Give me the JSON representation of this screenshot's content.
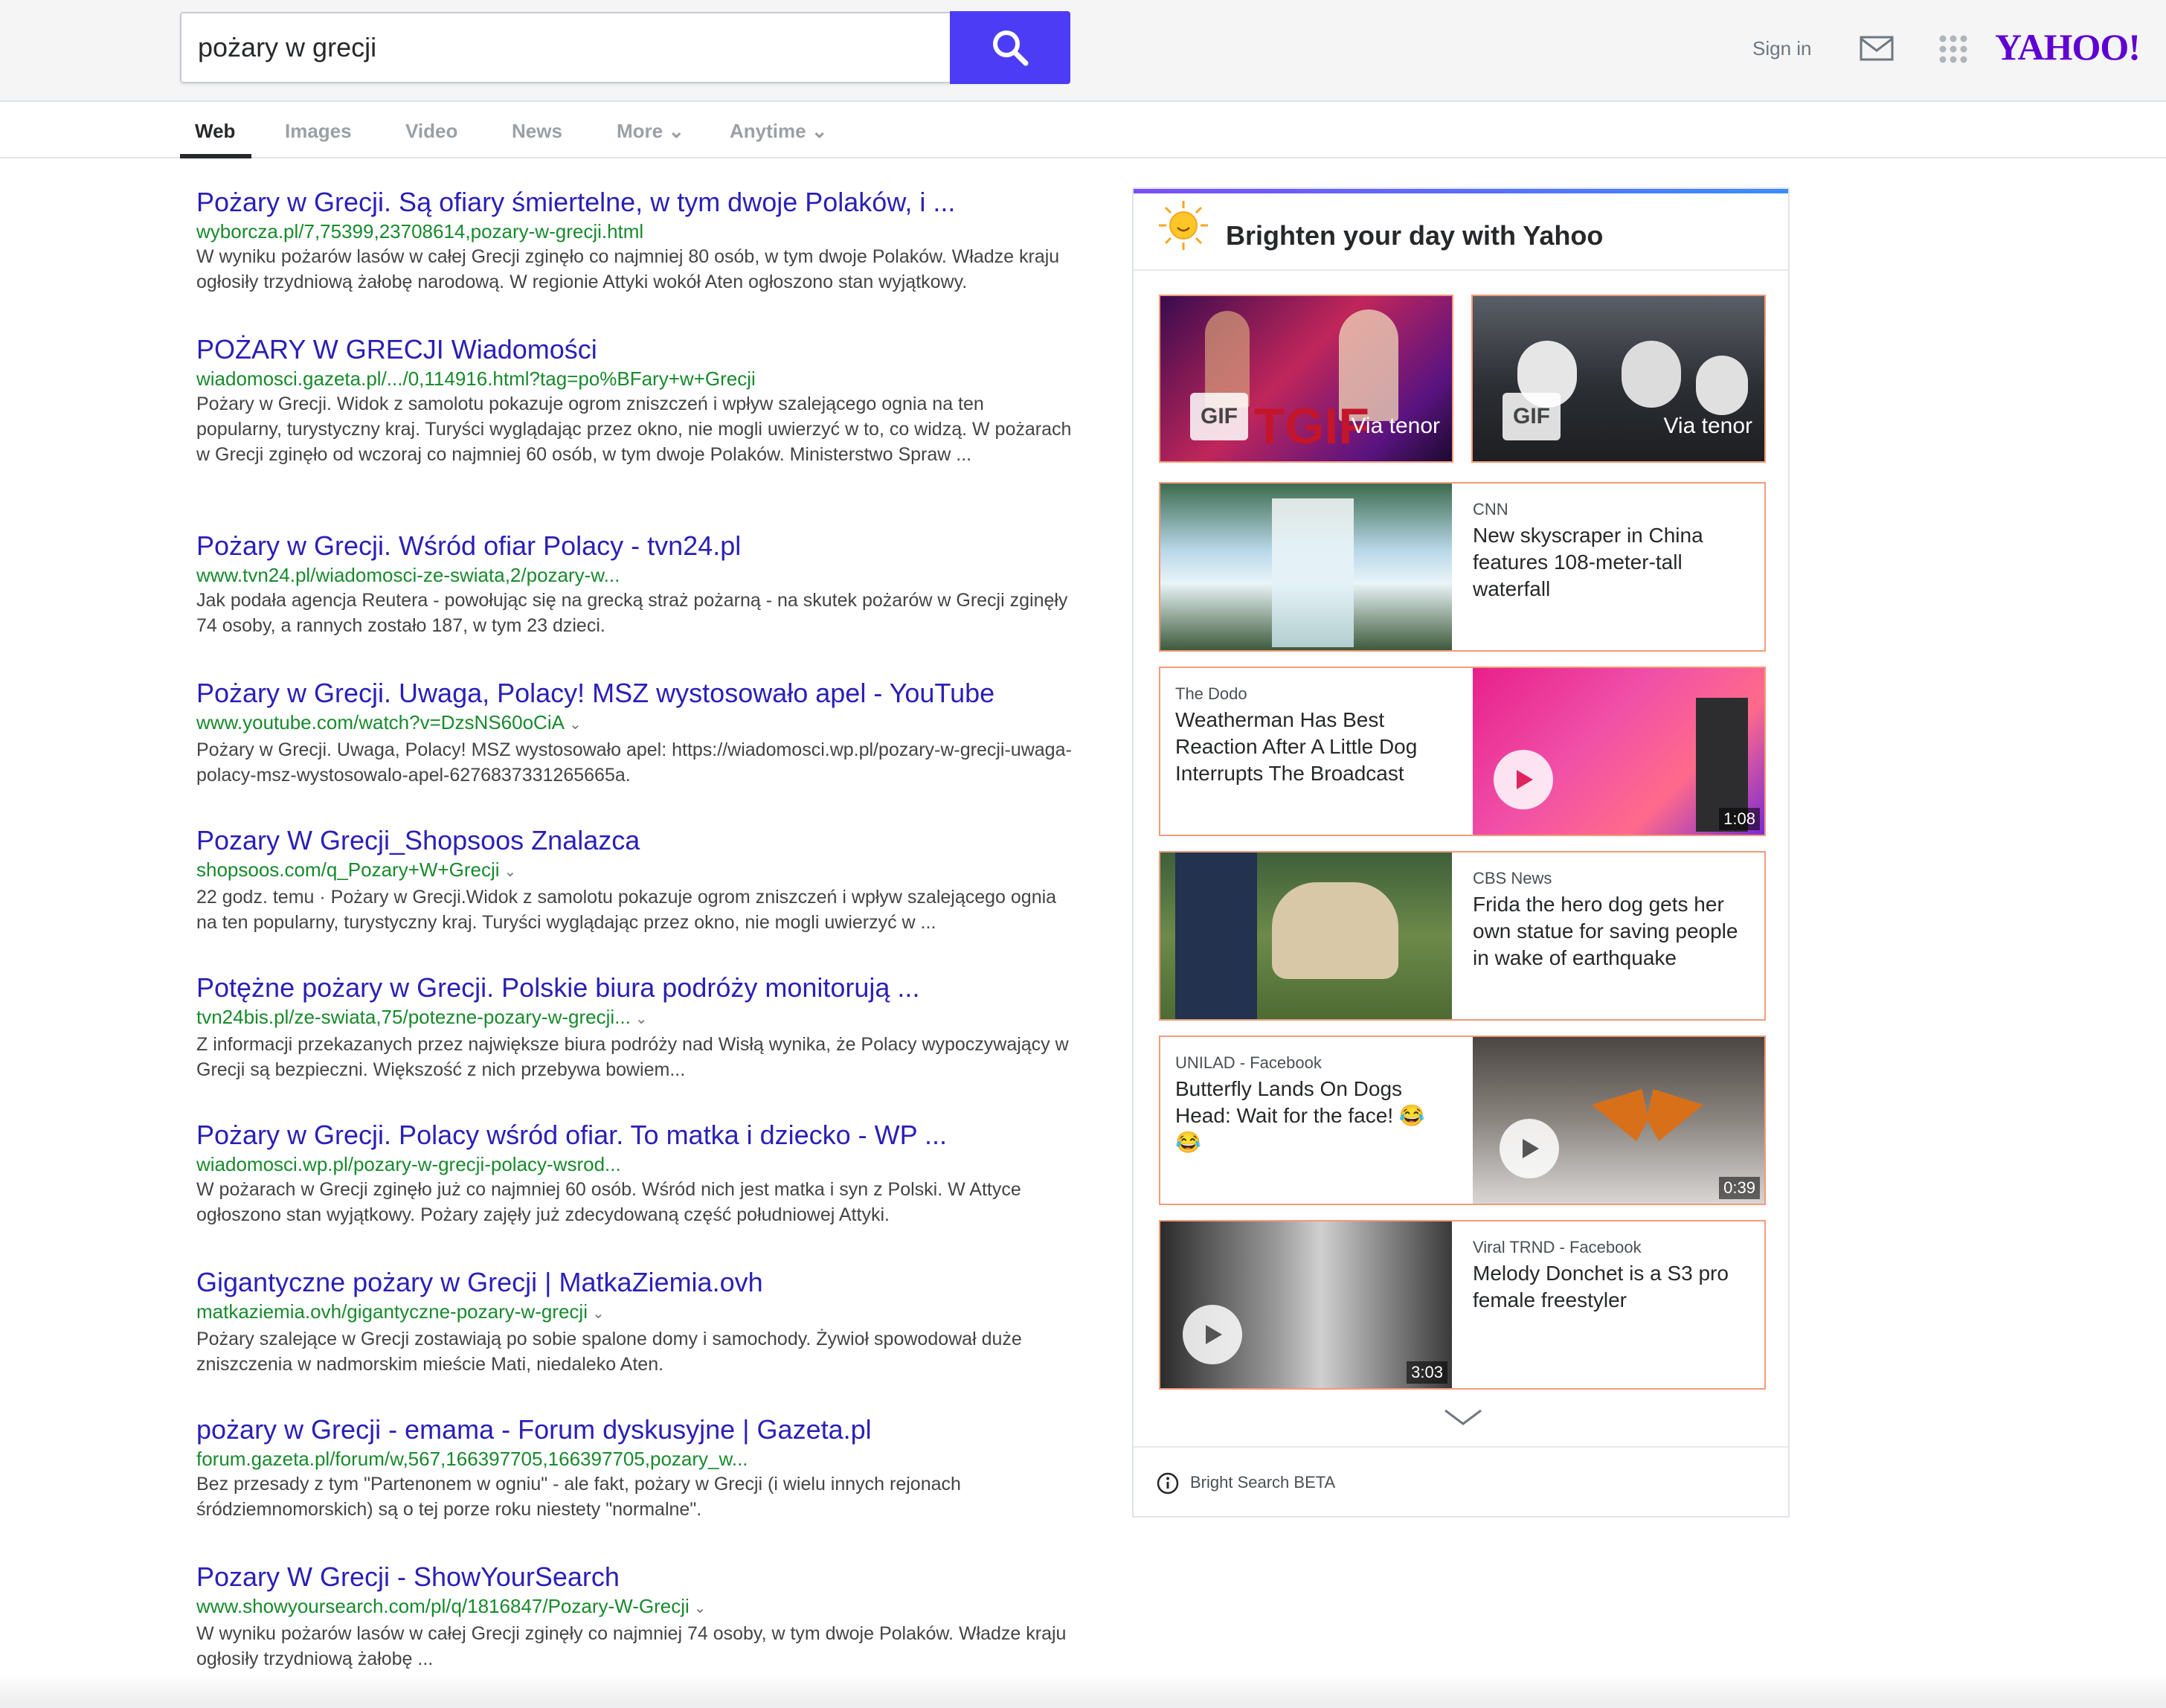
{
  "search": {
    "query": "pożary w grecji"
  },
  "header": {
    "signin": "Sign in",
    "logo": "YAHOO!"
  },
  "tabs": [
    {
      "label": "Web"
    },
    {
      "label": "Images"
    },
    {
      "label": "Video"
    },
    {
      "label": "News"
    },
    {
      "label": "More ⌄"
    },
    {
      "label": "Anytime ⌄"
    }
  ],
  "results": [
    {
      "title": "Pożary w Grecji. Są ofiary śmiertelne, w tym dwoje Polaków, i ...",
      "url": "wyborcza.pl/7,75399,23708614,pozary-w-grecji.html",
      "snippet": "W wyniku pożarów lasów w całej Grecji zginęło co najmniej 80 osób, w tym dwoje Polaków. Władze kraju ogłosiły trzydniową żałobę narodową. W regionie Attyki wokół Aten ogłoszono stan wyjątkowy."
    },
    {
      "title": "POŻARY W GRECJI Wiadomości",
      "url": "wiadomosci.gazeta.pl/.../0,114916.html?tag=po%BFary+w+Grecji",
      "snippet": "Pożary w Grecji. Widok z samolotu pokazuje ogrom zniszczeń i wpływ szalejącego ognia na ten popularny, turystyczny kraj. Turyści wyglądając przez okno, nie mogli uwierzyć w to, co widzą. W pożarach w Grecji zginęło od wczoraj co najmniej 60 osób, w tym dwoje Polaków. Ministerstwo Spraw ..."
    },
    {
      "title": "Pożary w Grecji. Wśród ofiar Polacy - tvn24.pl",
      "url": "www.tvn24.pl/wiadomosci-ze-swiata,2/pozary-w...",
      "snippet": "Jak podała agencja Reutera - powołując się na grecką straż pożarną - na skutek pożarów w Grecji zginęły 74 osoby, a rannych zostało 187, w tym 23 dzieci."
    },
    {
      "title": "Pożary w Grecji. Uwaga, Polacy! MSZ wystosowało apel - YouTube",
      "url": "www.youtube.com/watch?v=DzsNS60oCiA",
      "snippet": "Pożary w Grecji. Uwaga, Polacy! MSZ wystosowało apel: https://wiadomosci.wp.pl/pozary-w-grecji-uwaga-polacy-msz-wystosowalo-apel-6276837331265665a."
    },
    {
      "title": "Pozary W Grecji_Shopsoos Znalazca",
      "url": "shopsoos.com/q_Pozary+W+Grecji",
      "snippet": "22 godz. temu · Pożary w Grecji.Widok z samolotu pokazuje ogrom zniszczeń i wpływ szalejącego ognia na ten popularny, turystyczny kraj. Turyści wyglądając przez okno, nie mogli uwierzyć w ..."
    },
    {
      "title": "Potężne pożary w Grecji. Polskie biura podróży monitorują ...",
      "url": "tvn24bis.pl/ze-swiata,75/potezne-pozary-w-grecji...",
      "snippet": "Z informacji przekazanych przez największe biura podróży nad Wisłą wynika, że Polacy wypoczywający w Grecji są bezpieczni. Większość z nich przebywa bowiem..."
    },
    {
      "title": "Pożary w Grecji. Polacy wśród ofiar. To matka i dziecko - WP ...",
      "url": "wiadomosci.wp.pl/pozary-w-grecji-polacy-wsrod...",
      "snippet": "W pożarach w Grecji zginęło już co najmniej 60 osób. Wśród nich jest matka i syn z Polski. W Attyce ogłoszono stan wyjątkowy. Pożary zajęły już zdecydowaną część południowej Attyki."
    },
    {
      "title": "Gigantyczne pożary w Grecji | MatkaZiemia.ovh",
      "url": "matkaziemia.ovh/gigantyczne-pozary-w-grecji",
      "snippet": "Pożary szalejące w Grecji zostawiają po sobie spalone domy i samochody. Żywioł spowodował duże zniszczenia w nadmorskim mieście Mati, niedaleko Aten."
    },
    {
      "title": "pożary w Grecji - emama - Forum dyskusyjne | Gazeta.pl",
      "url": "forum.gazeta.pl/forum/w,567,166397705,166397705,pozary_w...",
      "snippet": "Bez przesady z tym \"Partenonem w ogniu\" - ale fakt, pożary w Grecji (i wielu innych rejonach śródziemnomorskich) są o tej porze roku niestety \"normalne\"."
    },
    {
      "title": "Pozary W Grecji - ShowYourSearch",
      "url": "www.showyoursearch.com/pl/q/1816847/Pozary-W-Grecji",
      "snippet": "W wyniku pożarów lasów w całej Grecji zginęły co najmniej 74 osoby, w tym dwoje Polaków. Władze kraju ogłosiły trzydniową żałobę ..."
    }
  ],
  "sidebar": {
    "title": "Brighten your day with Yahoo",
    "gifs": [
      {
        "badge": "GIF",
        "via": "Via tenor",
        "overlay": "TGIF"
      },
      {
        "badge": "GIF",
        "via": "Via tenor"
      }
    ],
    "cards": [
      {
        "source": "CNN",
        "title": "New skyscraper in China features 108-meter-tall waterfall"
      },
      {
        "source": "The Dodo",
        "title": "Weatherman Has Best Reaction After A Little Dog Interrupts The Broadcast",
        "duration": "1:08"
      },
      {
        "source": "CBS News",
        "title": "Frida the hero dog gets her own statue for saving people in wake of earthquake"
      },
      {
        "source": "UNILAD - Facebook",
        "title": "Butterfly Lands On Dogs Head: Wait for the face! 😂 😂",
        "duration": "0:39"
      },
      {
        "source": "Viral TRND - Facebook",
        "title": "Melody Donchet is a S3 pro female freestyler",
        "duration": "3:03"
      }
    ],
    "footer": "Bright Search BETA"
  },
  "colors": {
    "brand": "#5f01d1",
    "search_button": "#4d3cf5",
    "link": "#2a1fb8",
    "url": "#178a2b",
    "card_border": "#f39a7b"
  },
  "icons": [
    "search-icon",
    "mail-icon",
    "apps-grid-icon",
    "sun-icon",
    "play-icon",
    "chevron-down-icon",
    "info-icon"
  ]
}
